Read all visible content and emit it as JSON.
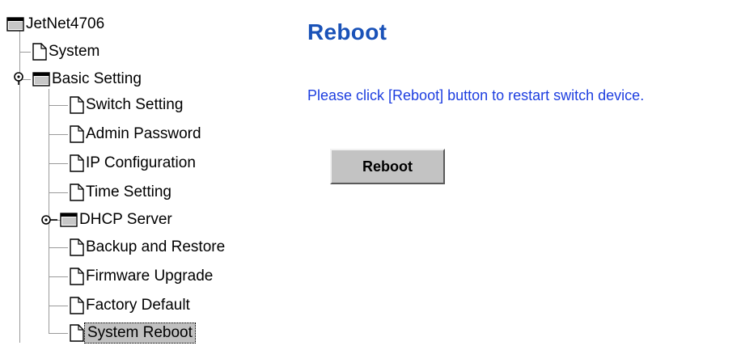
{
  "tree": {
    "root": "JetNet4706",
    "system": "System",
    "basic_setting": "Basic Setting",
    "items": [
      "Switch Setting",
      "Admin Password",
      "IP Configuration",
      "Time Setting",
      "DHCP Server",
      "Backup and Restore",
      "Firmware Upgrade",
      "Factory Default",
      "System Reboot"
    ]
  },
  "main": {
    "title": "Reboot",
    "message": "Please click [Reboot] button to restart switch device.",
    "reboot_button": "Reboot"
  }
}
